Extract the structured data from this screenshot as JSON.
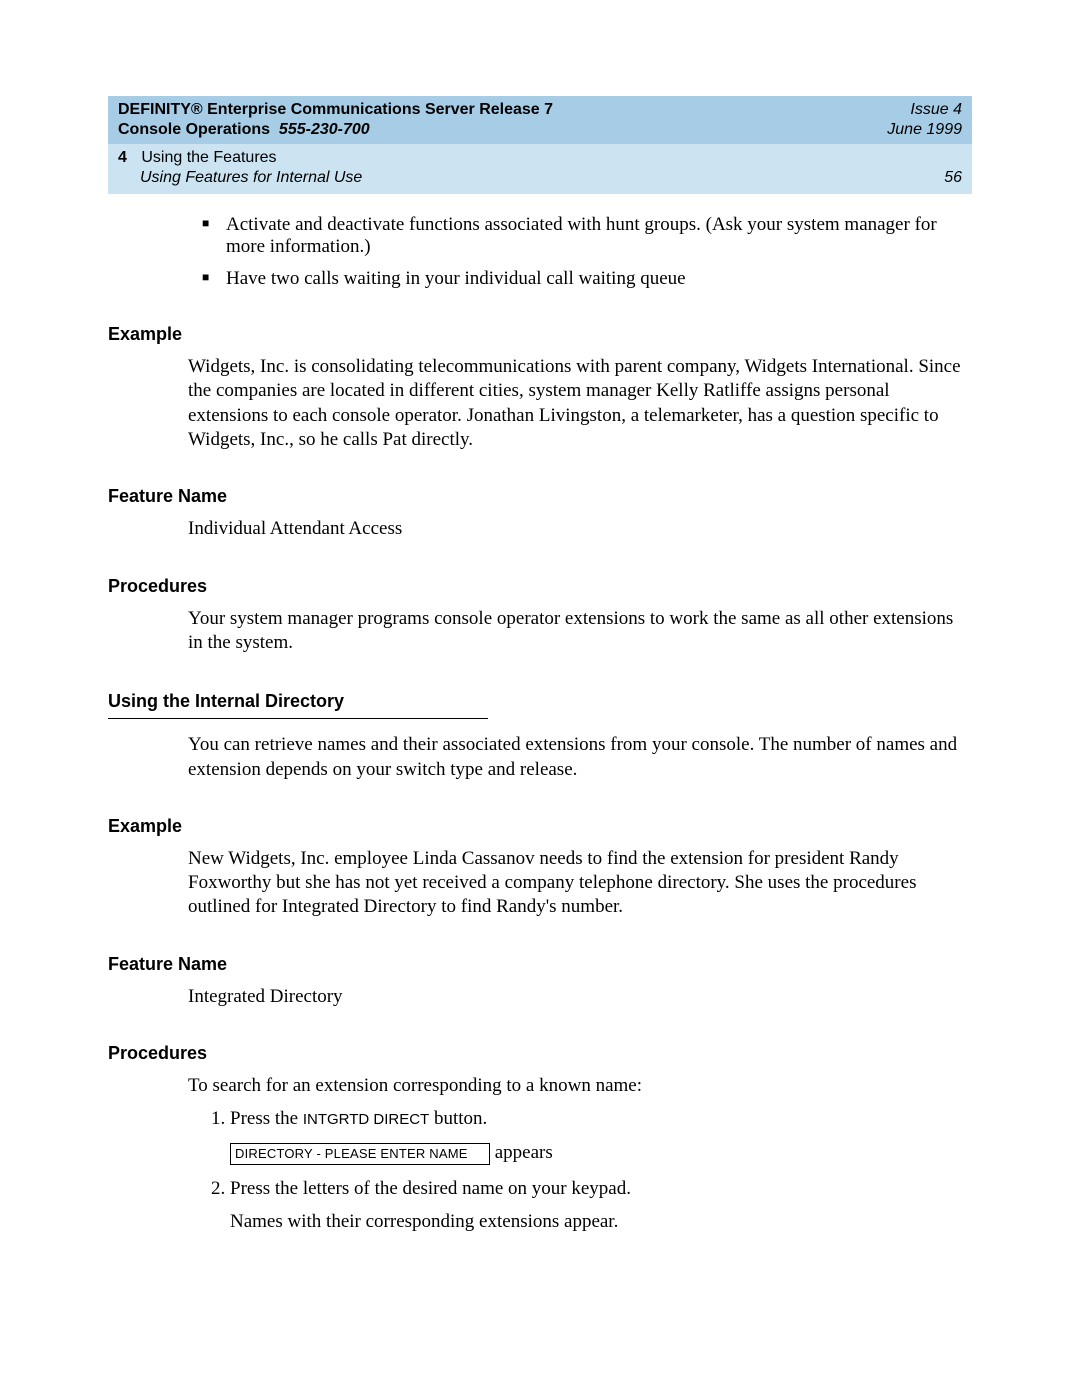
{
  "header": {
    "product": "DEFINITY® Enterprise Communications Server Release 7",
    "subtitle_label": "Console Operations",
    "docnum": "555-230-700",
    "issue": "Issue 4",
    "date": "June 1999",
    "chapter_num": "4",
    "chapter_title": "Using the Features",
    "subsection": "Using Features for Internal Use",
    "page": "56"
  },
  "bullets": {
    "b1": "Activate and deactivate functions associated with hunt groups. (Ask your system manager for more information.)",
    "b2": "Have two calls waiting in your individual call waiting queue"
  },
  "iaa": {
    "example_h": "Example",
    "example_p": "Widgets, Inc. is consolidating telecommunications with parent company, Widgets International. Since the companies are located in different cities, system manager Kelly Ratliffe assigns personal extensions to each console operator. Jonathan Livingston, a telemarketer, has a question specific to Widgets, Inc., so he calls Pat directly.",
    "fn_h": "Feature Name",
    "fn_p": "Individual Attendant Access",
    "proc_h": "Procedures",
    "proc_p": "Your system manager programs console operator extensions to work the same as all other extensions in the system."
  },
  "dir": {
    "major_h": "Using the Internal Directory",
    "intro": "You can retrieve names and their associated extensions from your console. The number of names and extension depends on your switch type and release.",
    "example_h": "Example",
    "example_p": "New Widgets, Inc. employee Linda Cassanov needs to find the extension for president Randy Foxworthy but she has not yet received a company telephone directory. She uses the procedures outlined for Integrated Directory to find Randy's number.",
    "fn_h": "Feature Name",
    "fn_p": "Integrated Directory",
    "proc_h": "Procedures",
    "proc_intro": "To search for an extension corresponding to a known name:",
    "step1_pre": "Press the ",
    "step1_btn": "INTGRTD DIRECT",
    "step1_post": " button.",
    "display_text": "DIRECTORY - PLEASE ENTER NAME",
    "display_after": " appears",
    "step2_a": "Press the letters of the desired name on your keypad.",
    "step2_b": "Names with their corresponding extensions appear."
  }
}
